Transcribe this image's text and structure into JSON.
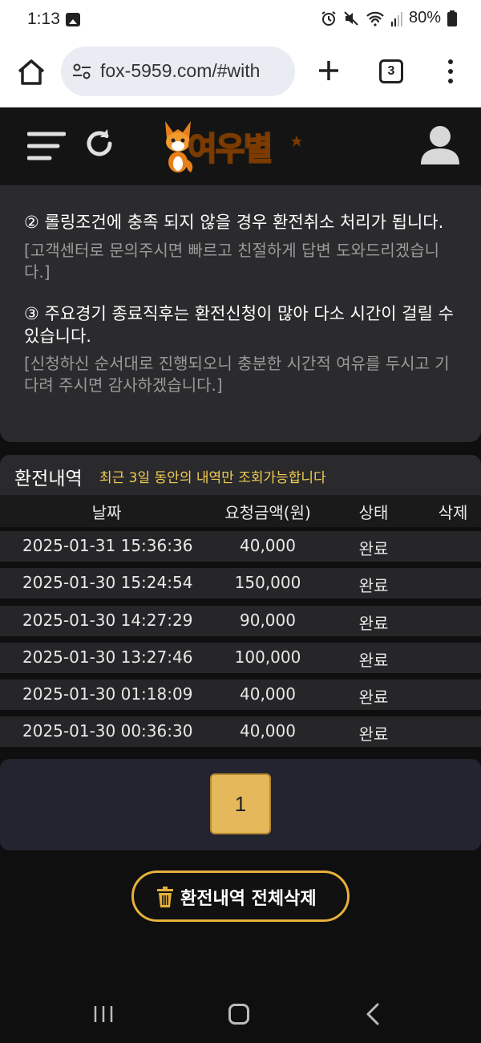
{
  "status_bar": {
    "time": "1:13",
    "battery": "80%"
  },
  "browser": {
    "url": "fox-5959.com/#with",
    "tab_count": "3"
  },
  "site": {
    "logo_text": "여우별"
  },
  "notice": {
    "cut_line": "",
    "item2": "② 롤링조건에 충족 되지 않을 경우 환전취소 처리가 됩니다.",
    "item2_sub": "[고객센터로 문의주시면 빠르고 친절하게 답변 도와드리겠습니다.]",
    "item3": "③ 주요경기 종료직후는 환전신청이 많아 다소 시간이 걸릴 수 있습니다.",
    "item3_sub": "[신청하신 순서대로 진행되오니 충분한 시간적 여유를 두시고 기다려 주시면 감사하겠습니다.]"
  },
  "history": {
    "title": "환전내역",
    "note": "최근 3일 동안의 내역만 조회가능합니다",
    "columns": {
      "date": "날짜",
      "amount": "요청금액(원)",
      "status": "상태",
      "delete": "삭제"
    },
    "rows": [
      {
        "date": "2025-01-31 15:36:36",
        "amount": "40,000",
        "status": "완료"
      },
      {
        "date": "2025-01-30 15:24:54",
        "amount": "150,000",
        "status": "완료"
      },
      {
        "date": "2025-01-30 14:27:29",
        "amount": "90,000",
        "status": "완료"
      },
      {
        "date": "2025-01-30 13:27:46",
        "amount": "100,000",
        "status": "완료"
      },
      {
        "date": "2025-01-30 01:18:09",
        "amount": "40,000",
        "status": "완료"
      },
      {
        "date": "2025-01-30 00:36:30",
        "amount": "40,000",
        "status": "완료"
      }
    ]
  },
  "pagination": {
    "current_page": "1"
  },
  "actions": {
    "delete_all_label": "환전내역 전체삭제"
  },
  "colors": {
    "accent_gold": "#e6b13b",
    "page_button": "#e6b85c",
    "note_yellow": "#f2cc55",
    "background": "#0f0f10"
  }
}
